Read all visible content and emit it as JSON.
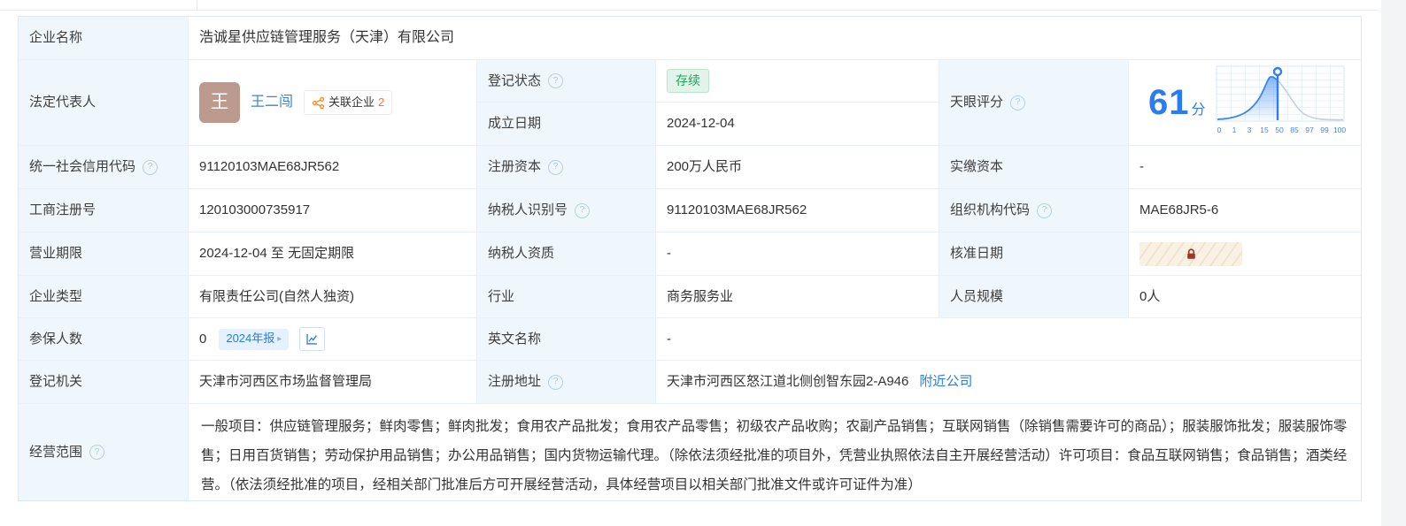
{
  "icons": {
    "help": "?",
    "caret": "▸"
  },
  "colors": {
    "label_bg": "#f0f7fc",
    "border": "#e9f0f7",
    "accent_blue": "#2a7de1",
    "score_blue": "#2b7cf0",
    "status_green": "#23a35c",
    "status_green_bg": "#e2f4e9",
    "related_orange": "#ff8c2e",
    "count_orange": "#ff7342",
    "avatar_bg": "#bd9a8e",
    "lock_red": "#a03526",
    "lock_bg": "#f8f1e4"
  },
  "company_name": {
    "label": "企业名称",
    "value": "浩诚星供应链管理服务（天津）有限公司"
  },
  "legal_rep": {
    "label": "法定代表人",
    "avatar_char": "王",
    "name": "王二闯",
    "related_label": "关联企业",
    "related_count": "2"
  },
  "fields": {
    "reg_status": {
      "label": "登记状态",
      "value": "存续"
    },
    "establish_date": {
      "label": "成立日期",
      "value": "2024-12-04"
    },
    "score": {
      "label": "天眼评分",
      "value": "61",
      "unit": "分"
    },
    "credit_code": {
      "label": "统一社会信用代码",
      "value": "91120103MAE68JR562"
    },
    "reg_capital": {
      "label": "注册资本",
      "value": "200万人民币"
    },
    "paid_capital": {
      "label": "实缴资本",
      "value": "-"
    },
    "biz_reg_no": {
      "label": "工商注册号",
      "value": "120103000735917"
    },
    "taxpayer_no": {
      "label": "纳税人识别号",
      "value": "91120103MAE68JR562"
    },
    "org_code": {
      "label": "组织机构代码",
      "value": "MAE68JR5-6"
    },
    "biz_term": {
      "label": "营业期限",
      "value": "2024-12-04 至 无固定期限"
    },
    "taxpayer_quali": {
      "label": "纳税人资质",
      "value": "-"
    },
    "approval_date": {
      "label": "核准日期"
    },
    "company_type": {
      "label": "企业类型",
      "value": "有限责任公司(自然人独资)"
    },
    "industry": {
      "label": "行业",
      "value": "商务服务业"
    },
    "staff_size": {
      "label": "人员规模",
      "value": "0人"
    },
    "insured": {
      "label": "参保人数",
      "value": "0",
      "report_badge": "2024年报"
    },
    "english_name": {
      "label": "英文名称",
      "value": "-"
    },
    "reg_authority": {
      "label": "登记机关",
      "value": "天津市河西区市场监督管理局"
    },
    "address": {
      "label": "注册地址",
      "value": "天津市河西区怒江道北侧创智东园2-A946",
      "nearby_link": "附近公司"
    },
    "scope": {
      "label": "经营范围",
      "value": "一般项目：供应链管理服务；鲜肉零售；鲜肉批发；食用农产品批发；食用农产品零售；初级农产品收购；农副产品销售；互联网销售（除销售需要许可的商品）；服装服饰批发；服装服饰零售；日用百货销售；劳动保护用品销售；办公用品销售；国内货物运输代理。（除依法须经批准的项目外，凭营业执照依法自主开展经营活动）许可项目：食品互联网销售；食品销售；酒类经营。（依法须经批准的项目，经相关部门批准后方可开展经营活动，具体经营项目以相关部门批准文件或许可证件为准）"
    }
  },
  "chart_data": {
    "type": "area",
    "title": "天眼评分分布曲线",
    "score": 61,
    "score_unit": "分",
    "x_tick_labels": [
      "0",
      "1",
      "3",
      "15",
      "50",
      "85",
      "97",
      "99",
      "100"
    ],
    "marker_x_fraction": 0.475,
    "grid": true,
    "legend_position": "none",
    "note": "钟形分布曲线，标记线左侧蓝色渐变填充，右侧灰色尾部"
  }
}
